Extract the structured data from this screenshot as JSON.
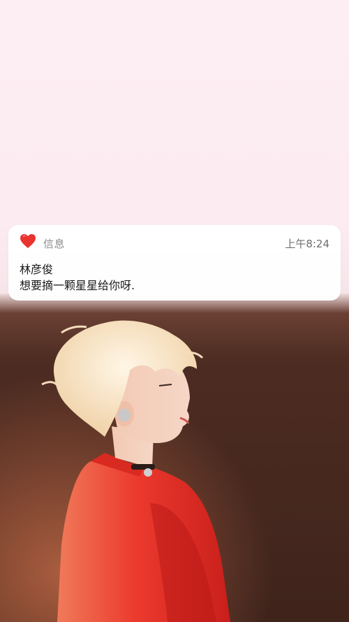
{
  "notification": {
    "app_icon": "heart-icon",
    "app_name": "信息",
    "time": "上午8:24",
    "sender": "林彦俊",
    "message": "想要摘一颗星星给你呀."
  },
  "colors": {
    "background": "#fdeef3",
    "heart": "#e8332f",
    "photo_backdrop": "#4a2a20",
    "jacket": "#e8372c"
  }
}
